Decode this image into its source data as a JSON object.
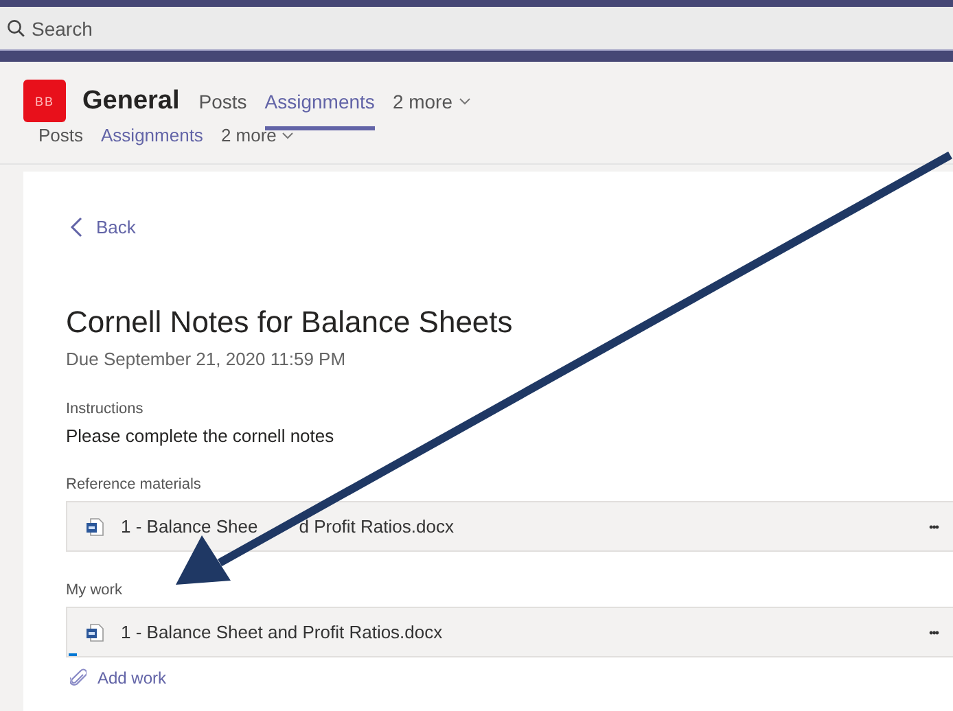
{
  "search": {
    "placeholder": "Search"
  },
  "team": {
    "initials": "BB",
    "channel": "General"
  },
  "tabs": [
    {
      "label": "Posts",
      "selected": false
    },
    {
      "label": "Assignments",
      "selected": true
    },
    {
      "label": "2 more",
      "selected": false,
      "kind": "more"
    }
  ],
  "tabs_duplicate": [
    {
      "label": "Posts",
      "selected": false
    },
    {
      "label": "Assignments",
      "selected": true
    },
    {
      "label": "2 more",
      "selected": false,
      "kind": "more"
    }
  ],
  "back": "Back",
  "assignment": {
    "title": "Cornell Notes for Balance Sheets",
    "due": "Due September 21, 2020 11:59 PM",
    "instructions_label": "Instructions",
    "instructions": "Please complete the cornell notes"
  },
  "sections": [
    {
      "label": "Reference materials",
      "files": [
        {
          "name_parts": [
            "1 - Balance Shee",
            "d Profit Ratios.docx"
          ],
          "more": "•••"
        }
      ]
    },
    {
      "label": "My work",
      "files": [
        {
          "name": "1 - Balance Sheet and Profit Ratios.docx",
          "more": "•••"
        }
      ]
    }
  ],
  "add_work": "Add work"
}
